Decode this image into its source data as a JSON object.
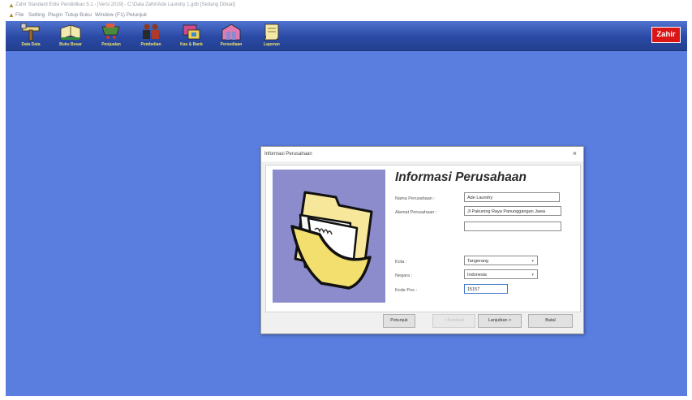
{
  "window": {
    "title": "Zahir Standard Edisi Pendidikan 5.1 - [Versi 2019] - C:\\Data Zahir\\Ade Laundry 1.gdb [Sedang Dibuat]"
  },
  "menu": [
    "File",
    "Setting",
    "Plugin",
    "Tutup Buku",
    "Window",
    "(F1) Petunjuk"
  ],
  "toolbar": {
    "buttons": [
      {
        "label": "Data Data",
        "icon": "wrench-hammer-icon"
      },
      {
        "label": "Buku Besar",
        "icon": "ledger-book-icon"
      },
      {
        "label": "Penjualan",
        "icon": "shopping-cart-icon"
      },
      {
        "label": "Pembelian",
        "icon": "people-icon"
      },
      {
        "label": "Kas & Bank",
        "icon": "bank-icon"
      },
      {
        "label": "Persediaan",
        "icon": "warehouse-icon"
      },
      {
        "label": "Laporan",
        "icon": "report-scroll-icon"
      }
    ],
    "brand": "Zahir"
  },
  "dialog": {
    "title": "Informasi Perusahaan",
    "heading": "Informasi Perusahaan",
    "fields": {
      "nama_label": "Nama Perusahaan :",
      "nama_value": "Ade Laundry",
      "alamat_label": "Alamat Perusahaan :",
      "alamat_line1": "Jl Pakuning Raya Panunggangan Jawa",
      "alamat_line2": "",
      "kota_label": "Kota :",
      "kota_value": "Tangerang",
      "negara_label": "Negara :",
      "negara_value": "Indonesia",
      "kodepos_label": "Kode Pos :",
      "kodepos_value": "15157"
    },
    "buttons": {
      "help": "Petunjuk",
      "back": "< Kembali",
      "next": "Lanjutkan >",
      "cancel": "Batal"
    },
    "close_symbol": "×"
  },
  "colors": {
    "desktop": "#5a7ee0",
    "toolbar": "#2a49a4",
    "illustration_bg": "#8c8ccc",
    "brand_red": "#d91515"
  }
}
